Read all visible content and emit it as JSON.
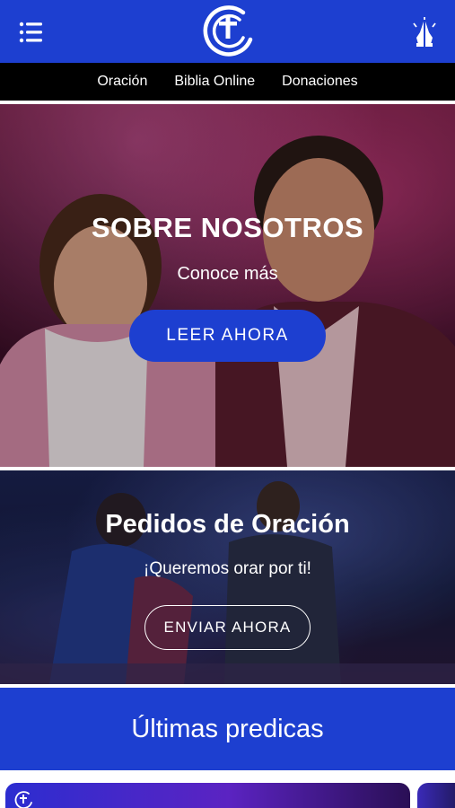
{
  "header": {
    "menu_icon": "hamburger-menu-icon",
    "logo_icon": "church-cross-logo",
    "pray_icon": "praying-hands-icon",
    "accent_color": "#1d3fd0"
  },
  "nav": {
    "items": [
      {
        "label": "Oración"
      },
      {
        "label": "Biblia Online"
      },
      {
        "label": "Donaciones"
      }
    ]
  },
  "hero": {
    "title": "SOBRE NOSOTROS",
    "subtitle": "Conoce más",
    "button_label": "LEER AHORA"
  },
  "prayer": {
    "title": "Pedidos de Oración",
    "subtitle": "¡Queremos orar por ti!",
    "button_label": "ENVIAR AHORA"
  },
  "sermons": {
    "title": "Últimas predicas"
  }
}
